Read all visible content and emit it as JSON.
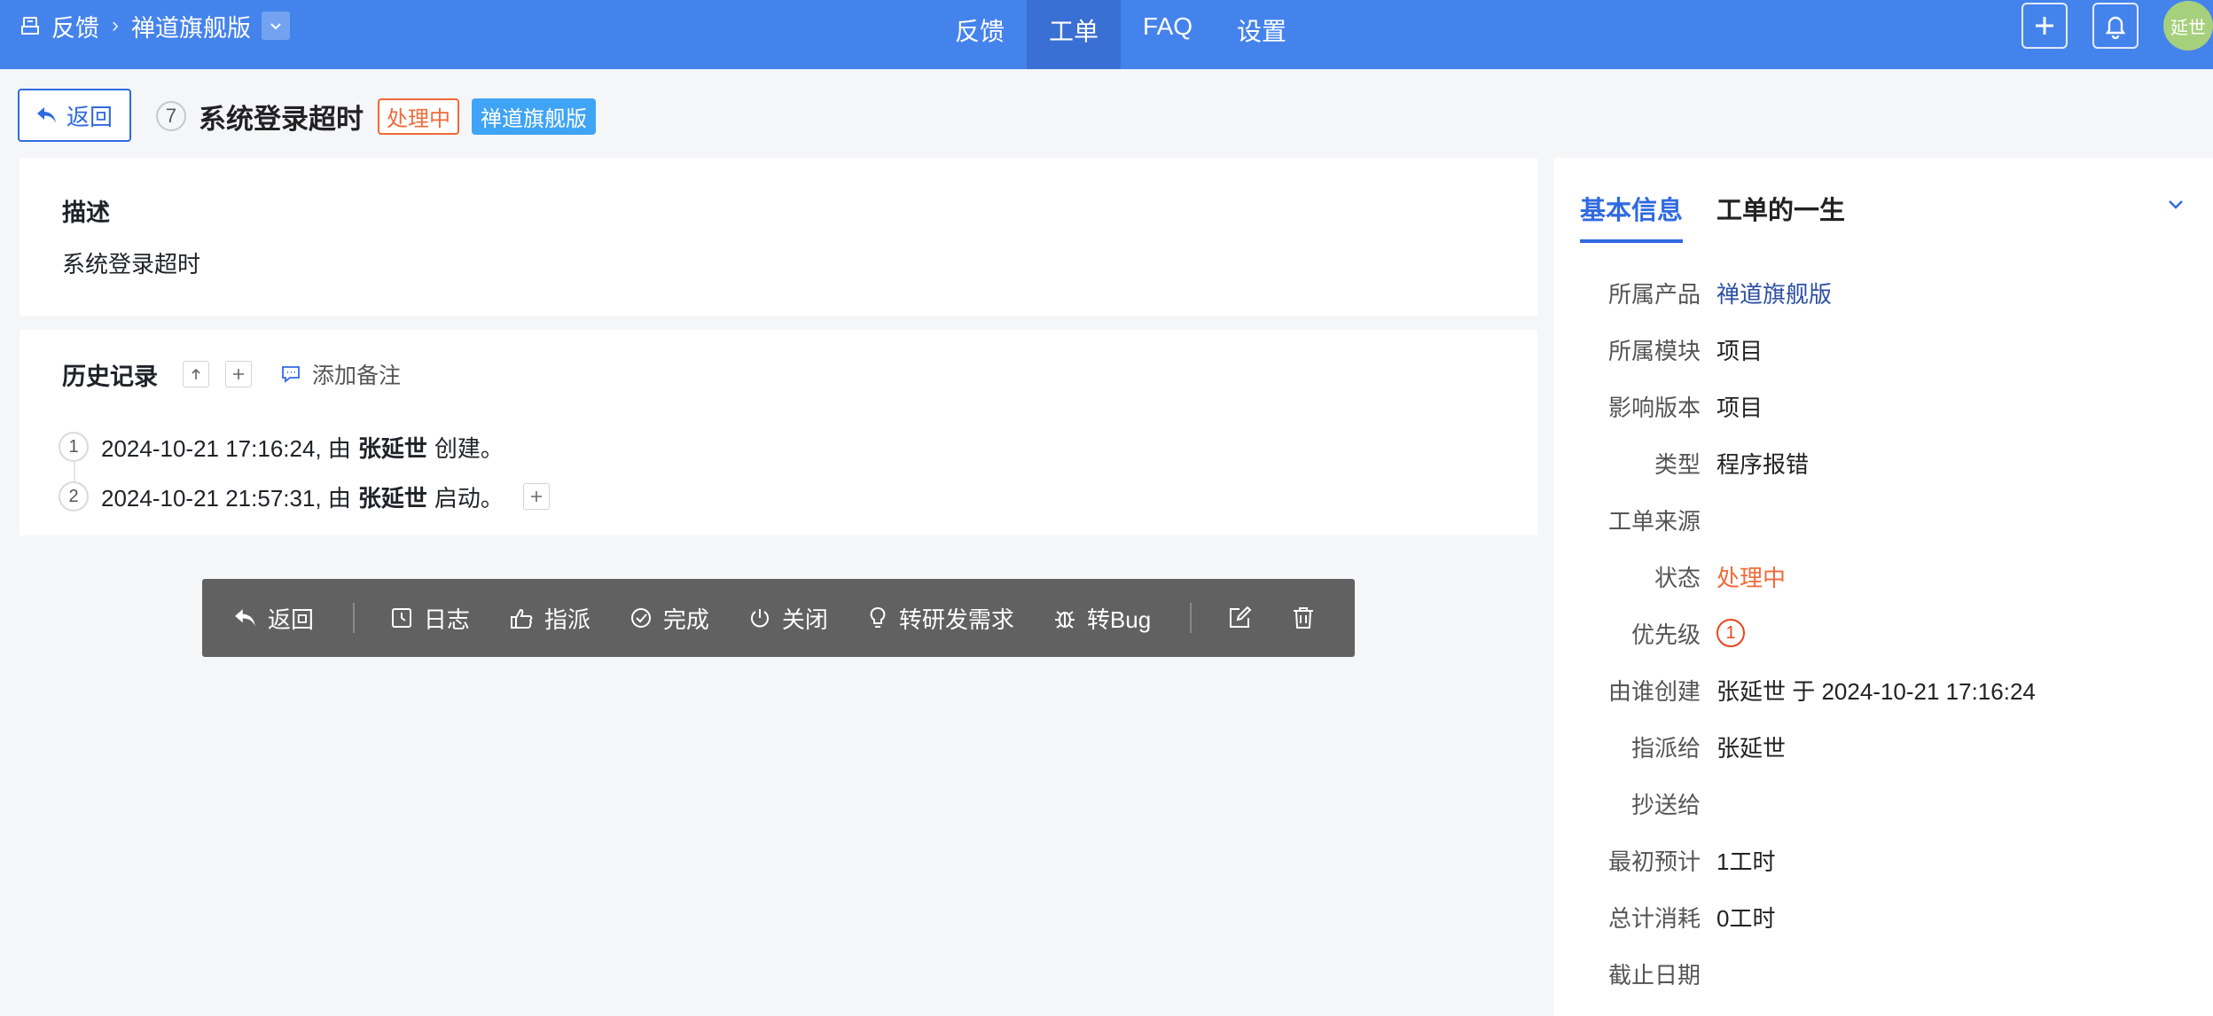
{
  "header": {
    "breadcrumb_root": "反馈",
    "breadcrumb_product": "禅道旗舰版",
    "nav_tabs": [
      {
        "label": "反馈",
        "active": false
      },
      {
        "label": "工单",
        "active": true
      },
      {
        "label": "FAQ",
        "active": false
      },
      {
        "label": "设置",
        "active": false
      }
    ],
    "avatar_text": "延世"
  },
  "ticket": {
    "back_label": "返回",
    "id": "7",
    "title": "系统登录超时",
    "status_badge": "处理中",
    "product_badge": "禅道旗舰版"
  },
  "description": {
    "heading": "描述",
    "text": "系统登录超时"
  },
  "history": {
    "heading": "历史记录",
    "add_note": "添加备注",
    "entries": [
      {
        "num": "1",
        "prefix": "2024-10-21 17:16:24, 由",
        "user": "张延世",
        "action": "创建。"
      },
      {
        "num": "2",
        "prefix": "2024-10-21 21:57:31, 由",
        "user": "张延世",
        "action": "启动。"
      }
    ]
  },
  "toolbar": {
    "back": "返回",
    "log": "日志",
    "assign": "指派",
    "finish": "完成",
    "close": "关闭",
    "to_story": "转研发需求",
    "to_bug": "转Bug"
  },
  "sidebar": {
    "tab_basic": "基本信息",
    "tab_life": "工单的一生",
    "fields": [
      {
        "key": "所属产品",
        "value": "禅道旗舰版",
        "style": "link"
      },
      {
        "key": "所属模块",
        "value": "项目",
        "style": ""
      },
      {
        "key": "影响版本",
        "value": "项目",
        "style": ""
      },
      {
        "key": "类型",
        "value": "程序报错",
        "style": ""
      },
      {
        "key": "工单来源",
        "value": "",
        "style": ""
      },
      {
        "key": "状态",
        "value": "处理中",
        "style": "orange"
      },
      {
        "key": "优先级",
        "value": "1",
        "style": "priority"
      },
      {
        "key": "由谁创建",
        "value": "张延世 于 2024-10-21 17:16:24",
        "style": ""
      },
      {
        "key": "指派给",
        "value": "张延世",
        "style": ""
      },
      {
        "key": "抄送给",
        "value": "",
        "style": ""
      },
      {
        "key": "最初预计",
        "value": "1工时",
        "style": ""
      },
      {
        "key": "总计消耗",
        "value": "0工时",
        "style": ""
      },
      {
        "key": "截止日期",
        "value": "",
        "style": ""
      }
    ]
  },
  "colors": {
    "topbar": "#4583ec",
    "accent": "#2f6ae0",
    "status_orange": "#f06a39",
    "product_badge": "#3fa4f5",
    "toolbar": "#616161"
  }
}
